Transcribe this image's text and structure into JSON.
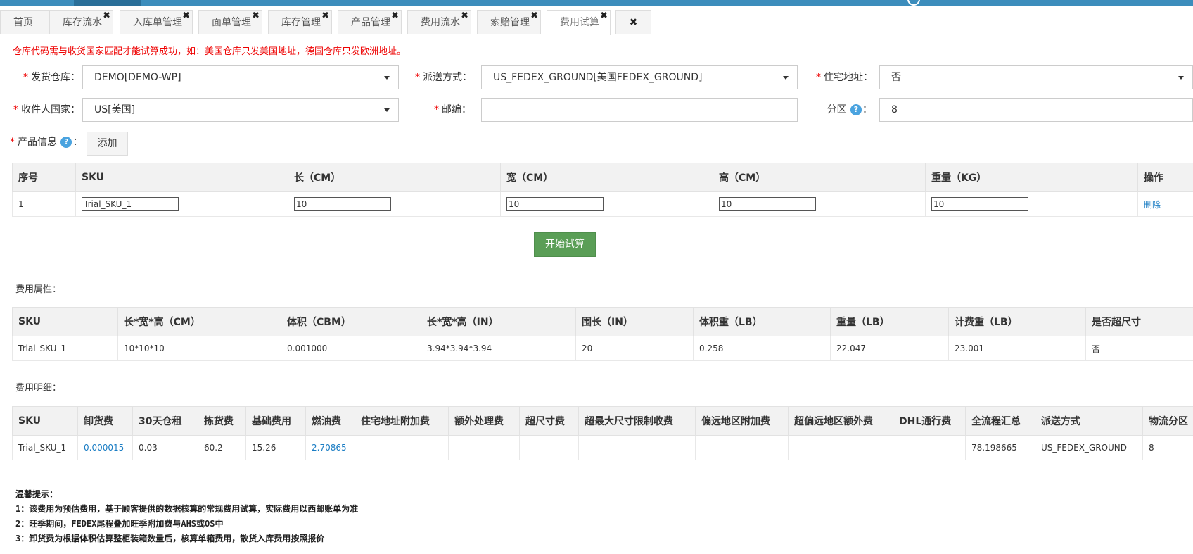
{
  "tabs": [
    {
      "label": "首页",
      "closable": false
    },
    {
      "label": "库存流水",
      "closable": true
    },
    {
      "label": "入库单管理",
      "closable": true
    },
    {
      "label": "面单管理",
      "closable": true
    },
    {
      "label": "库存管理",
      "closable": true
    },
    {
      "label": "产品管理",
      "closable": true
    },
    {
      "label": "费用流水",
      "closable": true
    },
    {
      "label": "索赔管理",
      "closable": true
    },
    {
      "label": "费用试算",
      "closable": true,
      "active": true
    }
  ],
  "close_glyph": "✖",
  "warning": "仓库代码需与收货国家匹配才能试算成功，如：美国仓库只发美国地址，德国仓库只发欧洲地址。",
  "form": {
    "warehouse": {
      "label": "发货仓库：",
      "value": "DEMO[DEMO-WP]"
    },
    "shipping": {
      "label": "派送方式：",
      "value": "US_FEDEX_GROUND[美国FEDEX_GROUND]"
    },
    "residential": {
      "label": "住宅地址：",
      "value": "否"
    },
    "country": {
      "label": "收件人国家：",
      "value": "US[美国]"
    },
    "zip": {
      "label": "邮编：",
      "value": ""
    },
    "zone": {
      "label": "分区",
      "colon": "：",
      "value": "8"
    },
    "product": {
      "label": "产品信息",
      "colon": "：",
      "add": "添加"
    },
    "help_glyph": "?",
    "required_mark": "*"
  },
  "product_table": {
    "headers": [
      "序号",
      "SKU",
      "长（CM）",
      "宽（CM）",
      "高（CM）",
      "重量（KG）",
      "操作"
    ],
    "rows": [
      {
        "index": "1",
        "sku": "Trial_SKU_1",
        "length": "10",
        "width": "10",
        "height": "10",
        "weight": "10",
        "action": "删除"
      }
    ]
  },
  "start_button": "开始试算",
  "attr_section": {
    "title": "费用属性：",
    "headers": [
      "SKU",
      "长*宽*高（CM）",
      "体积（CBM）",
      "长*宽*高（IN）",
      "围长（IN）",
      "体积重（LB）",
      "重量（LB）",
      "计费重（LB）",
      "是否超尺寸"
    ],
    "rows": [
      [
        "Trial_SKU_1",
        "10*10*10",
        "0.001000",
        "3.94*3.94*3.94",
        "20",
        "0.258",
        "22.047",
        "23.001",
        "否"
      ]
    ]
  },
  "detail_section": {
    "title": "费用明细：",
    "headers": [
      "SKU",
      "卸货费",
      "30天仓租",
      "拣货费",
      "基础费用",
      "燃油费",
      "住宅地址附加费",
      "额外处理费",
      "超尺寸费",
      "超最大尺寸限制收费",
      "偏远地区附加费",
      "超偏远地区额外费",
      "DHL通行费",
      "全流程汇总",
      "派送方式",
      "物流分区"
    ],
    "rows": [
      [
        "Trial_SKU_1",
        "0.000015",
        "0.03",
        "60.2",
        "15.26",
        "2.70865",
        "",
        "",
        "",
        "",
        "",
        "",
        "",
        "78.198665",
        "US_FEDEX_GROUND",
        "8"
      ]
    ]
  },
  "tips": {
    "title": "温馨提示：",
    "lines": [
      "1：该费用为预估费用，基于顾客提供的数据核算的常规费用试算，实际费用以西邮账单为准",
      "2：旺季期间，FEDEX尾程叠加旺季附加费与AHS或OS中",
      "3：卸货费为根据体积估算整柜装箱数量后，核算单箱费用，散货入库费用按照报价"
    ]
  }
}
